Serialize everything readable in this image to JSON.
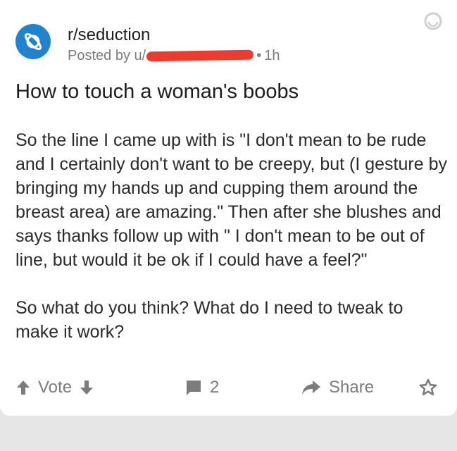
{
  "post": {
    "subreddit": "r/seduction",
    "posted_by_prefix": "Posted by u/",
    "separator": "•",
    "age": "1h",
    "title": "How to touch a woman's boobs",
    "body_paragraph_1": "So the line I came up with is \"I don't mean to be rude and I certainly don't want to be creepy, but (I gesture by bringing my hands up and cupping them around the breast area) are amazing.\" Then after she blushes and says thanks follow up with \" I don't mean to be out of line, but would it be ok if I could have a feel?\"",
    "body_paragraph_2": "So what do you think? What do I need to tweak to make it work?"
  },
  "actions": {
    "vote_label": "Vote",
    "comment_count": "2",
    "share_label": "Share"
  },
  "icons": {
    "avatar": "planet-icon",
    "upvote": "arrow-up-icon",
    "downvote": "arrow-down-icon",
    "comments": "comment-icon",
    "share": "share-arrow-icon",
    "save": "star-icon",
    "corner": "circular-badge-icon"
  },
  "colors": {
    "avatar_bg": "#1f83cf",
    "redaction": "#ef3b2d",
    "muted": "#7c7c7c"
  }
}
